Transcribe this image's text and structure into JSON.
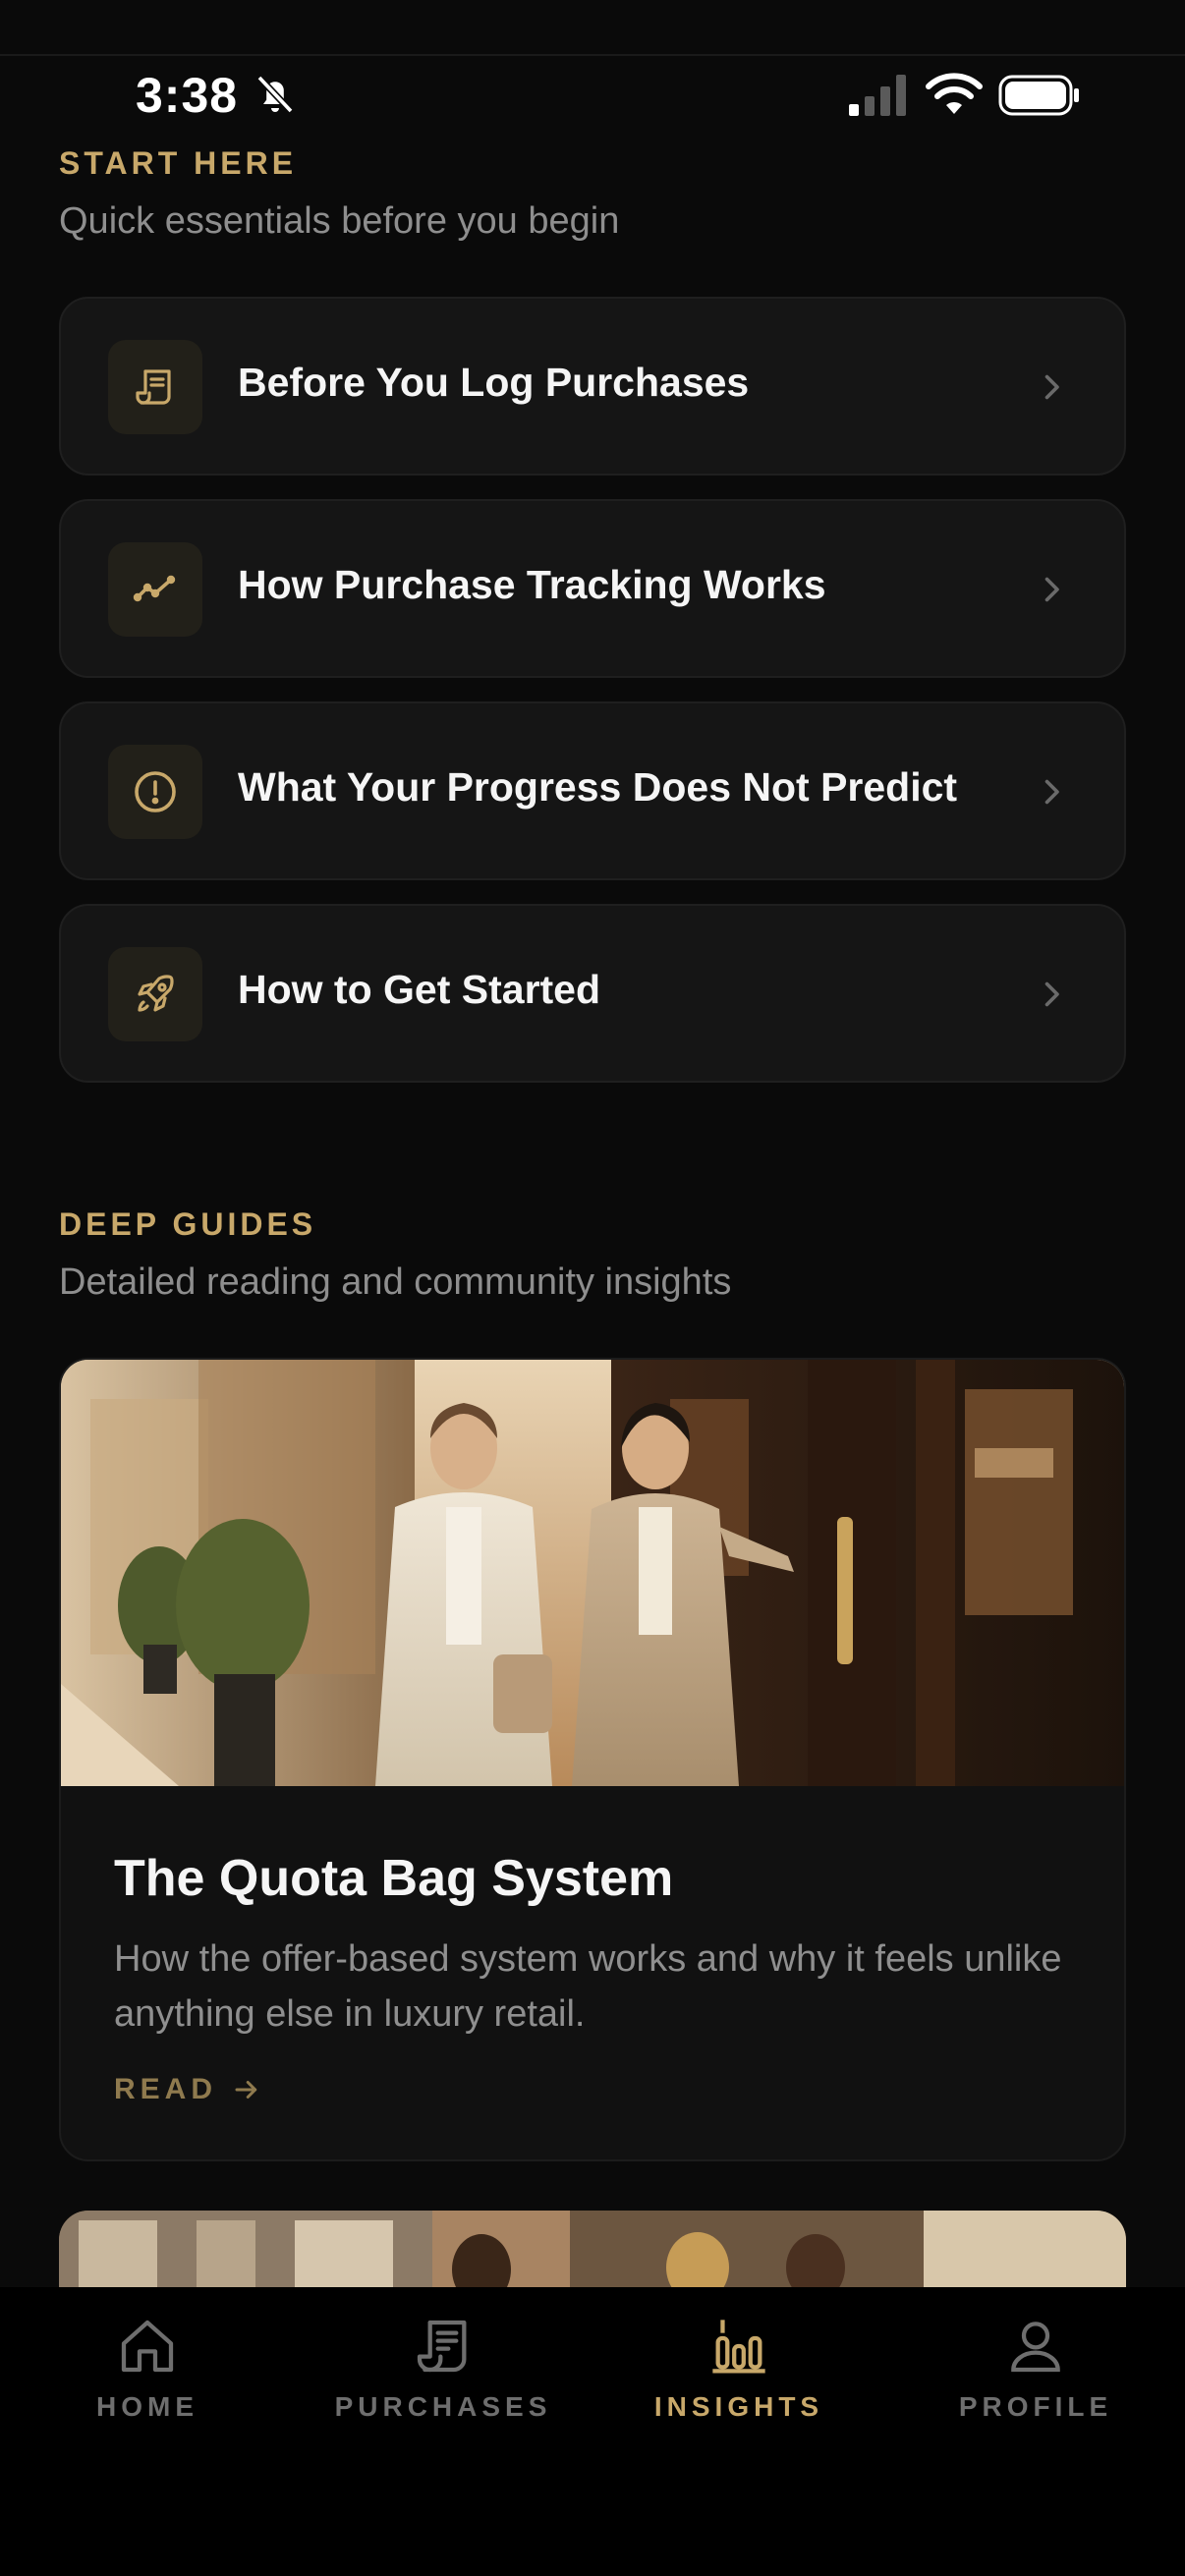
{
  "status_bar": {
    "time": "3:38"
  },
  "start_here": {
    "eyebrow": "START HERE",
    "subtitle": "Quick essentials before you begin",
    "items": [
      {
        "title": "Before You Log Purchases",
        "icon": "receipt-icon"
      },
      {
        "title": "How Purchase Tracking Works",
        "icon": "trend-line-icon"
      },
      {
        "title": "What Your Progress Does Not Predict",
        "icon": "alert-circle-icon"
      },
      {
        "title": "How to Get Started",
        "icon": "rocket-icon"
      }
    ]
  },
  "deep_guides": {
    "eyebrow": "DEEP GUIDES",
    "subtitle": "Detailed reading and community insights",
    "articles": [
      {
        "title": "The Quota Bag System",
        "description": "How the offer-based system works and why it feels unlike anything else in luxury retail.",
        "cta": "READ"
      }
    ]
  },
  "tab_bar": {
    "tabs": [
      {
        "label": "HOME",
        "icon": "home-icon"
      },
      {
        "label": "PURCHASES",
        "icon": "receipt-icon"
      },
      {
        "label": "INSIGHTS",
        "icon": "bar-chart-icon"
      },
      {
        "label": "PROFILE",
        "icon": "person-icon"
      }
    ],
    "active": "INSIGHTS"
  },
  "colors": {
    "background": "#0a0a0a",
    "card": "#151515",
    "accent_gold": "#c8a86a",
    "muted_text": "#8e8e8e",
    "tab_inactive": "#6e6e6e"
  }
}
